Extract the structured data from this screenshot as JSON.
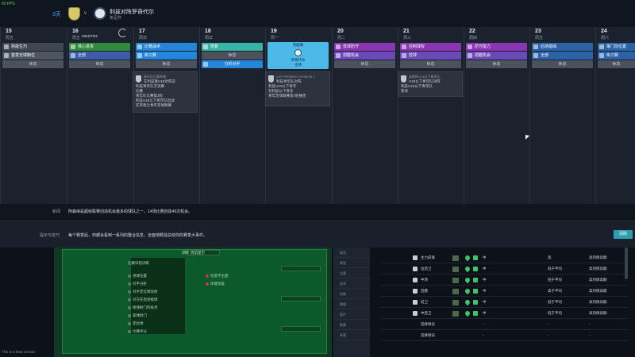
{
  "top_bar": {
    "fps": "60 FPS",
    "days_until": "3天",
    "vs": "v",
    "match_title": "利兹对阵罗奇代尔",
    "match_sub": "英足杯"
  },
  "calendar": {
    "date_marker": "2022/7/22",
    "days": [
      {
        "num": "15",
        "name": "周五",
        "slots": [
          [
            "c-gray",
            "熟能生巧"
          ],
          [
            "c-gray2",
            "首发无球跑位"
          ],
          [
            "c-rest",
            "休息"
          ]
        ]
      },
      {
        "num": "16",
        "name": "周五",
        "slots": [
          [
            "c-green",
            "核心进攻"
          ],
          [
            "c-blue2",
            "全部"
          ],
          [
            "c-rest",
            "休息"
          ]
        ]
      },
      {
        "num": "17",
        "name": "周日",
        "slots": [
          [
            "c-blue",
            "比赛战术"
          ],
          [
            "c-blue",
            "练习赛"
          ],
          [
            "c-rest",
            "休息"
          ]
        ]
      },
      {
        "num": "18",
        "name": "周日",
        "slots": [
          [
            "c-teal",
            "恢复"
          ],
          [
            "c-rest",
            "休息"
          ],
          [
            "c-blue",
            "分析对手"
          ]
        ]
      },
      {
        "num": "19",
        "name": "周一",
        "match": {
          "line1": "英超联",
          "line2": "罗奇代尔",
          "line3": "主场"
        }
      },
      {
        "num": "20",
        "name": "周二",
        "slots": [
          [
            "c-purple",
            "低球防守"
          ],
          [
            "c-purple2",
            "把握机会"
          ],
          [
            "c-rest",
            "休息"
          ]
        ]
      },
      {
        "num": "21",
        "name": "周三",
        "slots": [
          [
            "c-purple",
            "控制球权"
          ],
          [
            "c-purple2",
            "控球"
          ],
          [
            "c-rest",
            "休息"
          ]
        ]
      },
      {
        "num": "22",
        "name": "周四",
        "slots": [
          [
            "c-purple",
            "防守能力"
          ],
          [
            "c-purple2",
            "把握机会"
          ],
          [
            "c-rest",
            "休息"
          ]
        ]
      },
      {
        "num": "23",
        "name": "周五",
        "slots": [
          [
            "c-blue3",
            "后场基础"
          ],
          [
            "c-blue3",
            "全部"
          ],
          [
            "c-rest",
            "休息"
          ]
        ]
      },
      {
        "num": "24",
        "name": "周六",
        "slots": [
          [
            "c-blue3",
            "掌门前位置"
          ],
          [
            "c-blue3",
            "练习赛"
          ],
          [
            "c-rest",
            "休息"
          ]
        ]
      }
    ],
    "cards": [
      {
        "head": "青年队比赛结果",
        "lines": [
          "在利兹联U18对阵前",
          "利兹青年队交流赛",
          "比赛",
          "青年队比赛第3轮",
          "利兹U18以下青年队出战",
          "在英格兰青年足球联赛"
        ]
      },
      {
        "head": "U23 PREMIER DIVISION 1",
        "lines": [
          "利兹青年队对阵",
          "利兹U23以下青年",
          "对利兹以下青年",
          "青年足球联赛第4轮抽签"
        ]
      },
      {
        "head": "英联杯U23以下青年队",
        "lines": [
          "U18以下青年队对阵",
          "利兹U18以下青年队",
          "客场"
        ]
      }
    ]
  },
  "news": {
    "label": "新闻",
    "text": "阿森纳是超级联赛创造机会最多的球队之一，14场比赛创造49次机会。"
  },
  "tip": {
    "label": "提示与技巧",
    "text": "每个赛季后，你都会看到一系列的整合信息，全面地概括总结你的赛季大事件。",
    "button": "清除"
  },
  "lower": {
    "panel_header": "训练计划",
    "dropdown_a": "周前提示",
    "section_title": "比赛日程训练",
    "options_left": [
      "进球位置",
      "对手分析",
      "对手定位球攻防",
      "对方在后场接球",
      "接球射门的技术",
      "拿球射门",
      "定位球",
      "比赛评分"
    ],
    "options_right": [
      "任意不主题",
      "体能恢复"
    ],
    "side_labels": [
      "球员",
      "阵型",
      "比赛",
      "战术",
      "训练",
      "数据",
      "医疗",
      "联赛",
      "杯赛"
    ],
    "rows": [
      {
        "name": "主力前锋",
        "rating": "中",
        "level": "高",
        "value": "高热情高额"
      },
      {
        "name": "边后卫",
        "rating": "中",
        "level": "低于平均",
        "value": "高热情高额"
      },
      {
        "name": "中场",
        "rating": "中",
        "level": "低于平均",
        "value": "高热情高额"
      },
      {
        "name": "后腰",
        "rating": "中",
        "level": "高于平均",
        "value": "高热情高额"
      },
      {
        "name": "前卫",
        "rating": "中",
        "level": "低于平均",
        "value": "高热情高额"
      },
      {
        "name": "中后卫",
        "rating": "中",
        "level": "低于平均",
        "value": "高热情高额"
      },
      {
        "name": "选择球员",
        "rating": "-",
        "level": "-",
        "value": "-"
      },
      {
        "name": "选择球员",
        "rating": "-",
        "level": "-",
        "value": "-"
      }
    ]
  },
  "beta_notice": "This is a beta version"
}
